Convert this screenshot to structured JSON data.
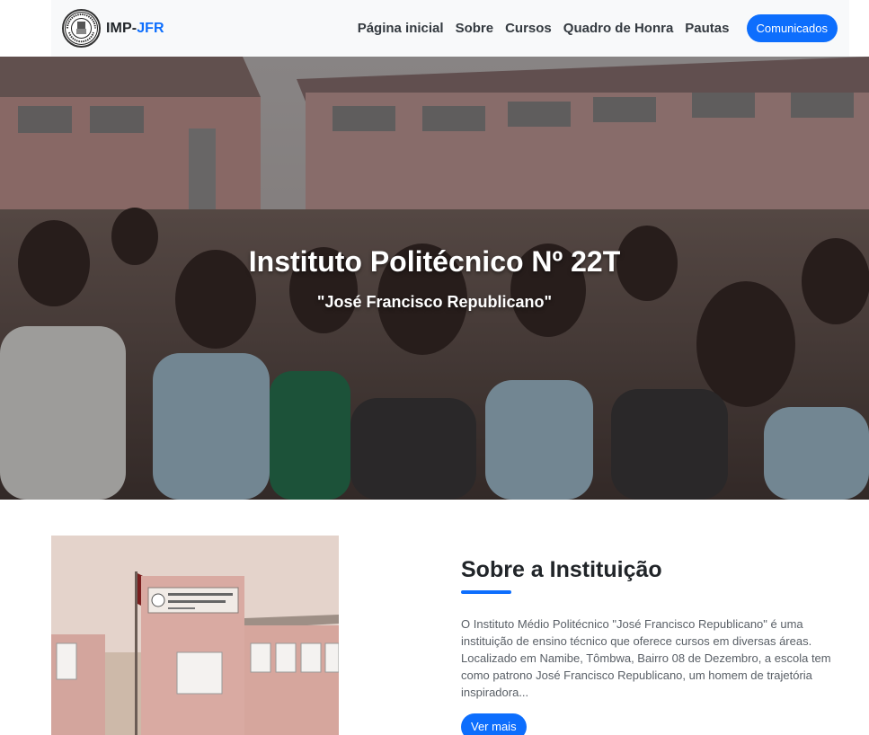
{
  "navbar": {
    "brand_prefix": "IMP-",
    "brand_accent": "JFR",
    "links": [
      "Página inicial",
      "Sobre",
      "Cursos",
      "Quadro de Honra",
      "Pautas"
    ],
    "cta_label": "Comunicados"
  },
  "hero": {
    "title": "Instituto Politécnico Nº 22T",
    "subtitle": "\"José Francisco Republicano\""
  },
  "about": {
    "title": "Sobre a Instituição",
    "text": "O Instituto Médio Politécnico \"José Francisco Republicano\" é uma instituição de ensino técnico que oferece cursos em diversas áreas. Localizado em Namibe, Tômbwa, Bairro 08 de Dezembro, a escola tem como patrono José Francisco Republicano, um homem de trajetória inspiradora...",
    "button_label": "Ver mais"
  },
  "colors": {
    "accent": "#0d6efd",
    "navbar_bg": "#f8f9fa"
  }
}
